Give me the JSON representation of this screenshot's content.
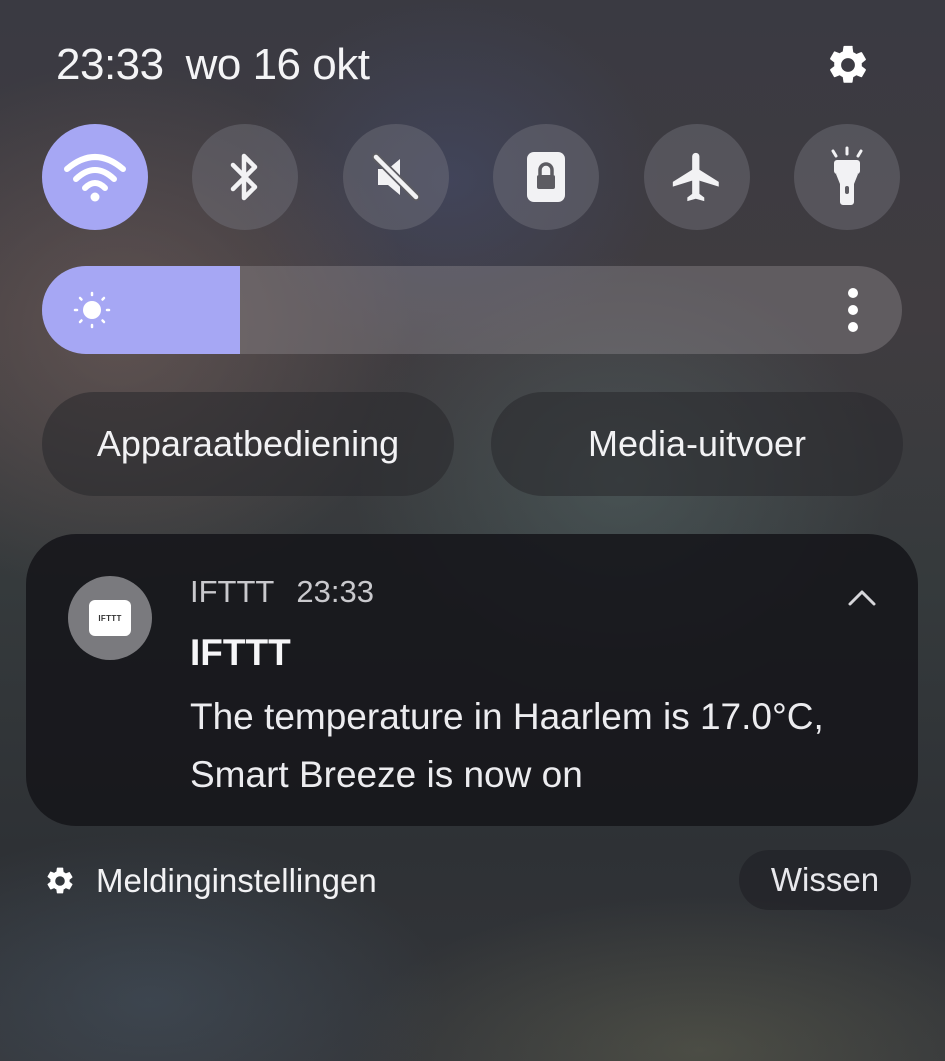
{
  "status_bar": {
    "time": "23:33",
    "date": "wo 16 okt",
    "settings_icon": "gear-icon"
  },
  "quick_settings": {
    "tiles": [
      {
        "id": "wifi",
        "icon": "wifi-icon",
        "active": true
      },
      {
        "id": "bluetooth",
        "icon": "bluetooth-icon",
        "active": false
      },
      {
        "id": "sound",
        "icon": "mute-icon",
        "active": false
      },
      {
        "id": "rotation-lock",
        "icon": "lock-icon",
        "active": false
      },
      {
        "id": "airplane",
        "icon": "airplane-icon",
        "active": false
      },
      {
        "id": "flashlight",
        "icon": "flashlight-icon",
        "active": false
      }
    ],
    "brightness_level": 0.23,
    "accent_color": "#a6a7f4"
  },
  "buttons": {
    "device_control": "Apparaatbediening",
    "media_output": "Media-uitvoer"
  },
  "notification": {
    "app_name": "IFTTT",
    "time": "23:33",
    "app_icon_label": "IFTTT",
    "title": "IFTTT",
    "body": "The temperature in Haarlem is 17.0°C, Smart Breeze is now on"
  },
  "footer": {
    "notification_settings": "Meldinginstellingen",
    "clear": "Wissen"
  }
}
